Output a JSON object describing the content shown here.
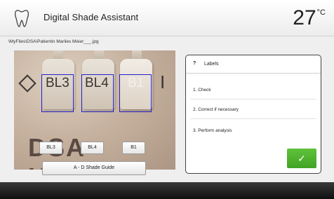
{
  "header": {
    "title": "Digital Shade Assistant",
    "temperature": "27",
    "temperature_unit": "°C",
    "icon": "tooth-icon"
  },
  "file_path": "\\MyFiles\\DSA\\Patientin Marlies Meier___.jpg",
  "photo": {
    "tabs": [
      "BL3",
      "BL4",
      "B1"
    ],
    "holder_text": "DSA Holder",
    "detected_labels": [
      "BL3",
      "BL4",
      "B1"
    ],
    "detection_color": "#2222cc"
  },
  "shade_buttons": [
    "BL3",
    "BL4",
    "B1"
  ],
  "shade_guide_button": "A - D Shade Guide",
  "labels_panel": {
    "icon": "question-icon",
    "title": "Labels",
    "steps": [
      "1. Check",
      "2. Correct if necessary",
      "3. Perform analysis"
    ],
    "confirm_icon": "checkmark-icon",
    "confirm_glyph": "✓",
    "confirm_color": "#4caf2e"
  }
}
